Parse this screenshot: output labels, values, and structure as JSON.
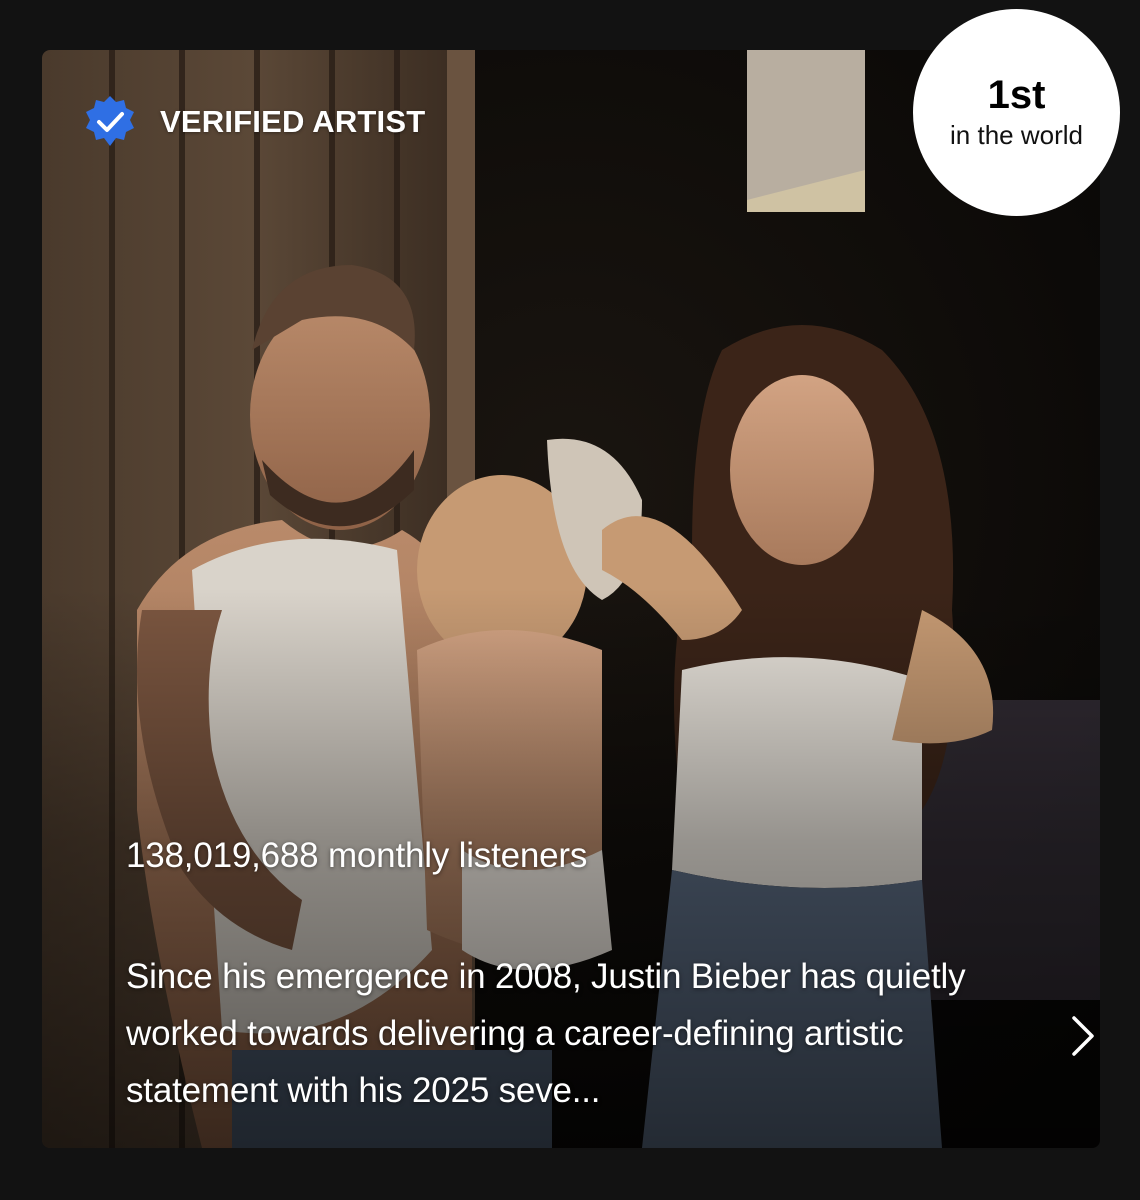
{
  "badge": {
    "label": "VERIFIED ARTIST",
    "icon": "verified-check-icon",
    "color": "#2f6fe4"
  },
  "rank": {
    "position": "1st",
    "scope": "in the world"
  },
  "artist": {
    "monthly_listeners": "138,019,688 monthly listeners",
    "bio": "Since his emergence in 2008, Justin Bieber has quietly worked towards delivering a career-defining artistic statement with his 2025 seve...",
    "bio_icon": "chevron-right-icon"
  },
  "photo": {
    "description_icon": "artist-photo"
  }
}
